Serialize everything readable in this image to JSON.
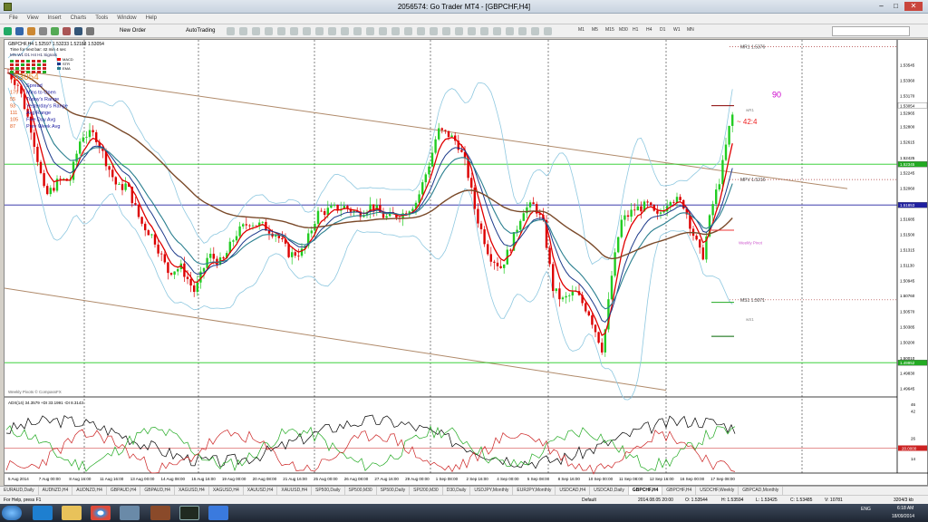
{
  "window": {
    "title": "2056574: Go Trader MT4 - [GBPCHF,H4]"
  },
  "menu": [
    "File",
    "View",
    "Insert",
    "Charts",
    "Tools",
    "Window",
    "Help"
  ],
  "toolbar": {
    "new_order": "New Order",
    "autotrading": "AutoTrading",
    "timeframes": [
      "M1",
      "M5",
      "M15",
      "M30",
      "H1",
      "H4",
      "D1",
      "W1",
      "MN"
    ]
  },
  "chart": {
    "symbol_info": "GBPCHF,H4  1.52597 1.53233 1.52188 1.53054",
    "timer_text": "Time for next bar: 42 min 4 sec",
    "tf_row": "MN  W1  D1  H4  H1  Signals",
    "ma_labels": [
      "MACD",
      "STR",
      "EMA"
    ],
    "big_price": "53054",
    "info_rows": [
      {
        "value": "",
        "label": "Spread"
      },
      {
        "value": "179",
        "label": "Mins to Open"
      },
      {
        "value": "55",
        "label": "Today's Range"
      },
      {
        "value": "93",
        "label": "Yesterday's Range"
      },
      {
        "value": "111",
        "label": "Avg Range"
      },
      {
        "value": "105",
        "label": "Five Day Avg"
      },
      {
        "value": "87",
        "label": "Prev Week Avg"
      }
    ],
    "countdown": "~ 42:4",
    "countdown_value": "90",
    "pivots": {
      "MR1": "MR1  1.5376",
      "WR1": "wR1",
      "MPV": "MPV  1.5216",
      "WP": "Weekly Pivot",
      "MS1": "MS1  1.5071",
      "WS1": "wS1"
    },
    "watermark": "Weekly Pivots © CompassFX",
    "price_axis": [
      "1.53545",
      "1.53360",
      "1.53170",
      "1.52965",
      "1.52800",
      "1.52615",
      "1.52425",
      "1.52245",
      "1.52060",
      "1.51870",
      "1.51685",
      "1.51500",
      "1.51315",
      "1.51130",
      "1.50945",
      "1.50760",
      "1.50570",
      "1.50385",
      "1.50200",
      "1.50010",
      "1.49830",
      "1.49645"
    ],
    "price_tags": [
      {
        "text": "1.53054",
        "color": "#000000",
        "bg": "#ffffff"
      },
      {
        "text": "1.52345",
        "color": "#ffffff",
        "bg": "#22aa22"
      },
      {
        "text": "1.51853",
        "color": "#ffffff",
        "bg": "#2020a0"
      },
      {
        "text": "1.49952",
        "color": "#ffffff",
        "bg": "#22aa22"
      }
    ],
    "date_axis": [
      "5 Aug 2014",
      "7 Aug 00:00",
      "8 Aug 16:00",
      "11 Aug 16:00",
      "13 Aug 00:00",
      "14 Aug 08:00",
      "15 Aug 16:00",
      "19 Aug 00:00",
      "20 Aug 08:00",
      "21 Aug 16:00",
      "25 Aug 00:00",
      "26 Aug 08:00",
      "27 Aug 16:00",
      "29 Aug 00:00",
      "1 Sep 08:00",
      "2 Sep 16:00",
      "4 Sep 00:00",
      "5 Sep 08:00",
      "8 Sep 16:00",
      "10 Sep 00:00",
      "11 Sep 08:00",
      "12 Sep 16:00",
      "16 Sep 00:00",
      "17 Sep 08:00"
    ],
    "adx": {
      "label": "ADX(14) 34.3579 +DI 33.1991 -DI 8.3143",
      "axis": [
        "46",
        "42",
        "26",
        "20",
        "14"
      ],
      "tag": "20.0000"
    }
  },
  "tabs": [
    "EURAUD,Daily",
    "AUDNZD,H4",
    "AUDNZD,H4",
    "GBPAUD,H4",
    "GBPAUD,H4",
    "XAGUSD,H4",
    "XAGUSD,H4",
    "XAUUSD,H4",
    "XAUUSD,H4",
    "SP500,Daily",
    "SP500,M30",
    "SP500,Daily",
    "SPI200,M30",
    "D30,Daily",
    "USDJPY,Monthly",
    "EURJPY,Monthly",
    "USDCAD,H4",
    "USDCAD,Daily",
    "GBPCHF,H4",
    "GBPCHF,H4",
    "USDCHF,Weekly",
    "GBPCAD,Monthly"
  ],
  "active_tab": 18,
  "status": {
    "help": "For Help, press F1",
    "profile": "Default",
    "time": "2014.08.05 20:00",
    "open": "O: 1.53544",
    "high": "H: 1.53594",
    "low": "L: 1.53425",
    "close": "C: 1.53485",
    "volume": "V: 10781",
    "bars": "3204/3 kb"
  },
  "taskbar": {
    "lang": "ENG",
    "time": "6:18 AM",
    "date": "18/09/2014"
  },
  "colors": {
    "up": "#22cc22",
    "down": "#dd0000",
    "ma_red": "#e00000",
    "ma_teal": "#2a7f8f",
    "ma_brown": "#7a4a2a",
    "bands": "#8ec8e0",
    "channel": "#b08a6a",
    "green_level": "#22cc22",
    "blue_level": "#2020a0"
  }
}
